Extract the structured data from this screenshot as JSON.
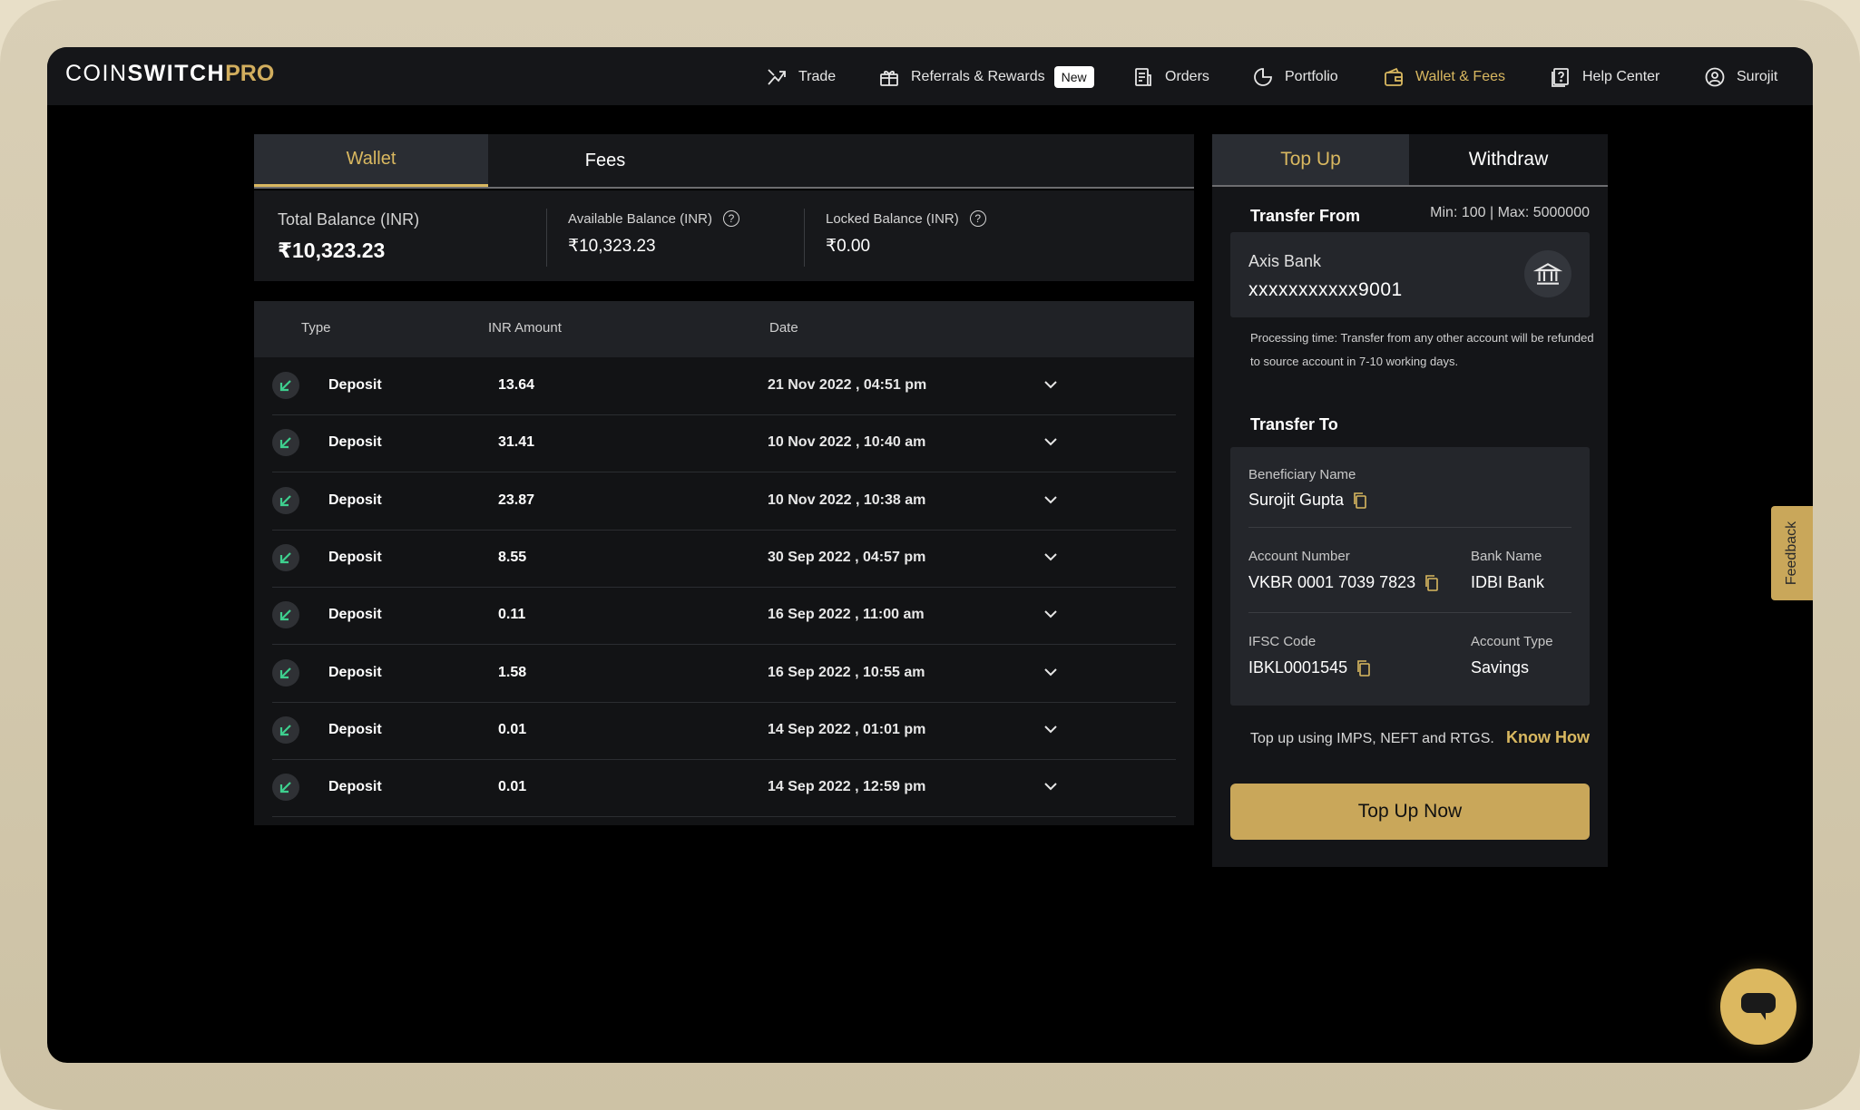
{
  "app": {
    "logo_main": "COIN",
    "logo_bold": "SWITCH",
    "logo_pro": "PRO"
  },
  "nav": {
    "trade": "Trade",
    "referrals": "Referrals & Rewards",
    "new_badge": "New",
    "orders": "Orders",
    "portfolio": "Portfolio",
    "wallet_fees": "Wallet & Fees",
    "help": "Help Center",
    "user": "Surojit"
  },
  "left_tabs": {
    "wallet": "Wallet",
    "fees": "Fees"
  },
  "balances": {
    "total_label": "Total Balance (INR)",
    "total_value": "₹10,323.23",
    "available_label": "Available Balance (INR)",
    "available_value": "₹10,323.23",
    "locked_label": "Locked Balance (INR)",
    "locked_value": "₹0.00"
  },
  "table": {
    "headers": {
      "type": "Type",
      "amount": "INR Amount",
      "date": "Date"
    },
    "rows": [
      {
        "type": "Deposit",
        "amount": "13.64",
        "date": "21 Nov 2022 , 04:51 pm"
      },
      {
        "type": "Deposit",
        "amount": "31.41",
        "date": "10 Nov 2022 , 10:40 am"
      },
      {
        "type": "Deposit",
        "amount": "23.87",
        "date": "10 Nov 2022 , 10:38 am"
      },
      {
        "type": "Deposit",
        "amount": "8.55",
        "date": "30 Sep 2022 , 04:57 pm"
      },
      {
        "type": "Deposit",
        "amount": "0.11",
        "date": "16 Sep 2022 , 11:00 am"
      },
      {
        "type": "Deposit",
        "amount": "1.58",
        "date": "16 Sep 2022 , 10:55 am"
      },
      {
        "type": "Deposit",
        "amount": "0.01",
        "date": "14 Sep 2022 , 01:01 pm"
      },
      {
        "type": "Deposit",
        "amount": "0.01",
        "date": "14 Sep 2022 , 12:59 pm"
      }
    ]
  },
  "right": {
    "tab_topup": "Top Up",
    "tab_withdraw": "Withdraw",
    "transfer_from": "Transfer From",
    "min_max": "Min: 100 | Max: 5000000",
    "bank_name": "Axis Bank",
    "bank_account": "xxxxxxxxxxx9001",
    "processing": "Processing time: Transfer from any other account will be refunded to source account in 7-10 working days.",
    "transfer_to": "Transfer To",
    "beneficiary_label": "Beneficiary Name",
    "beneficiary_value": "Surojit Gupta",
    "account_label": "Account Number",
    "account_value": "VKBR 0001 7039 7823",
    "bankname_label": "Bank Name",
    "bankname_value": "IDBI Bank",
    "ifsc_label": "IFSC Code",
    "ifsc_value": "IBKL0001545",
    "acctype_label": "Account Type",
    "acctype_value": "Savings",
    "topup_info": "Top up using IMPS, NEFT and RTGS.",
    "know_how": "Know How",
    "topup_button": "Top Up Now"
  },
  "feedback": "Feedback",
  "colors": {
    "accent": "#d9b860",
    "button": "#c9a75a",
    "deposit_icon": "#3ecf8e"
  }
}
